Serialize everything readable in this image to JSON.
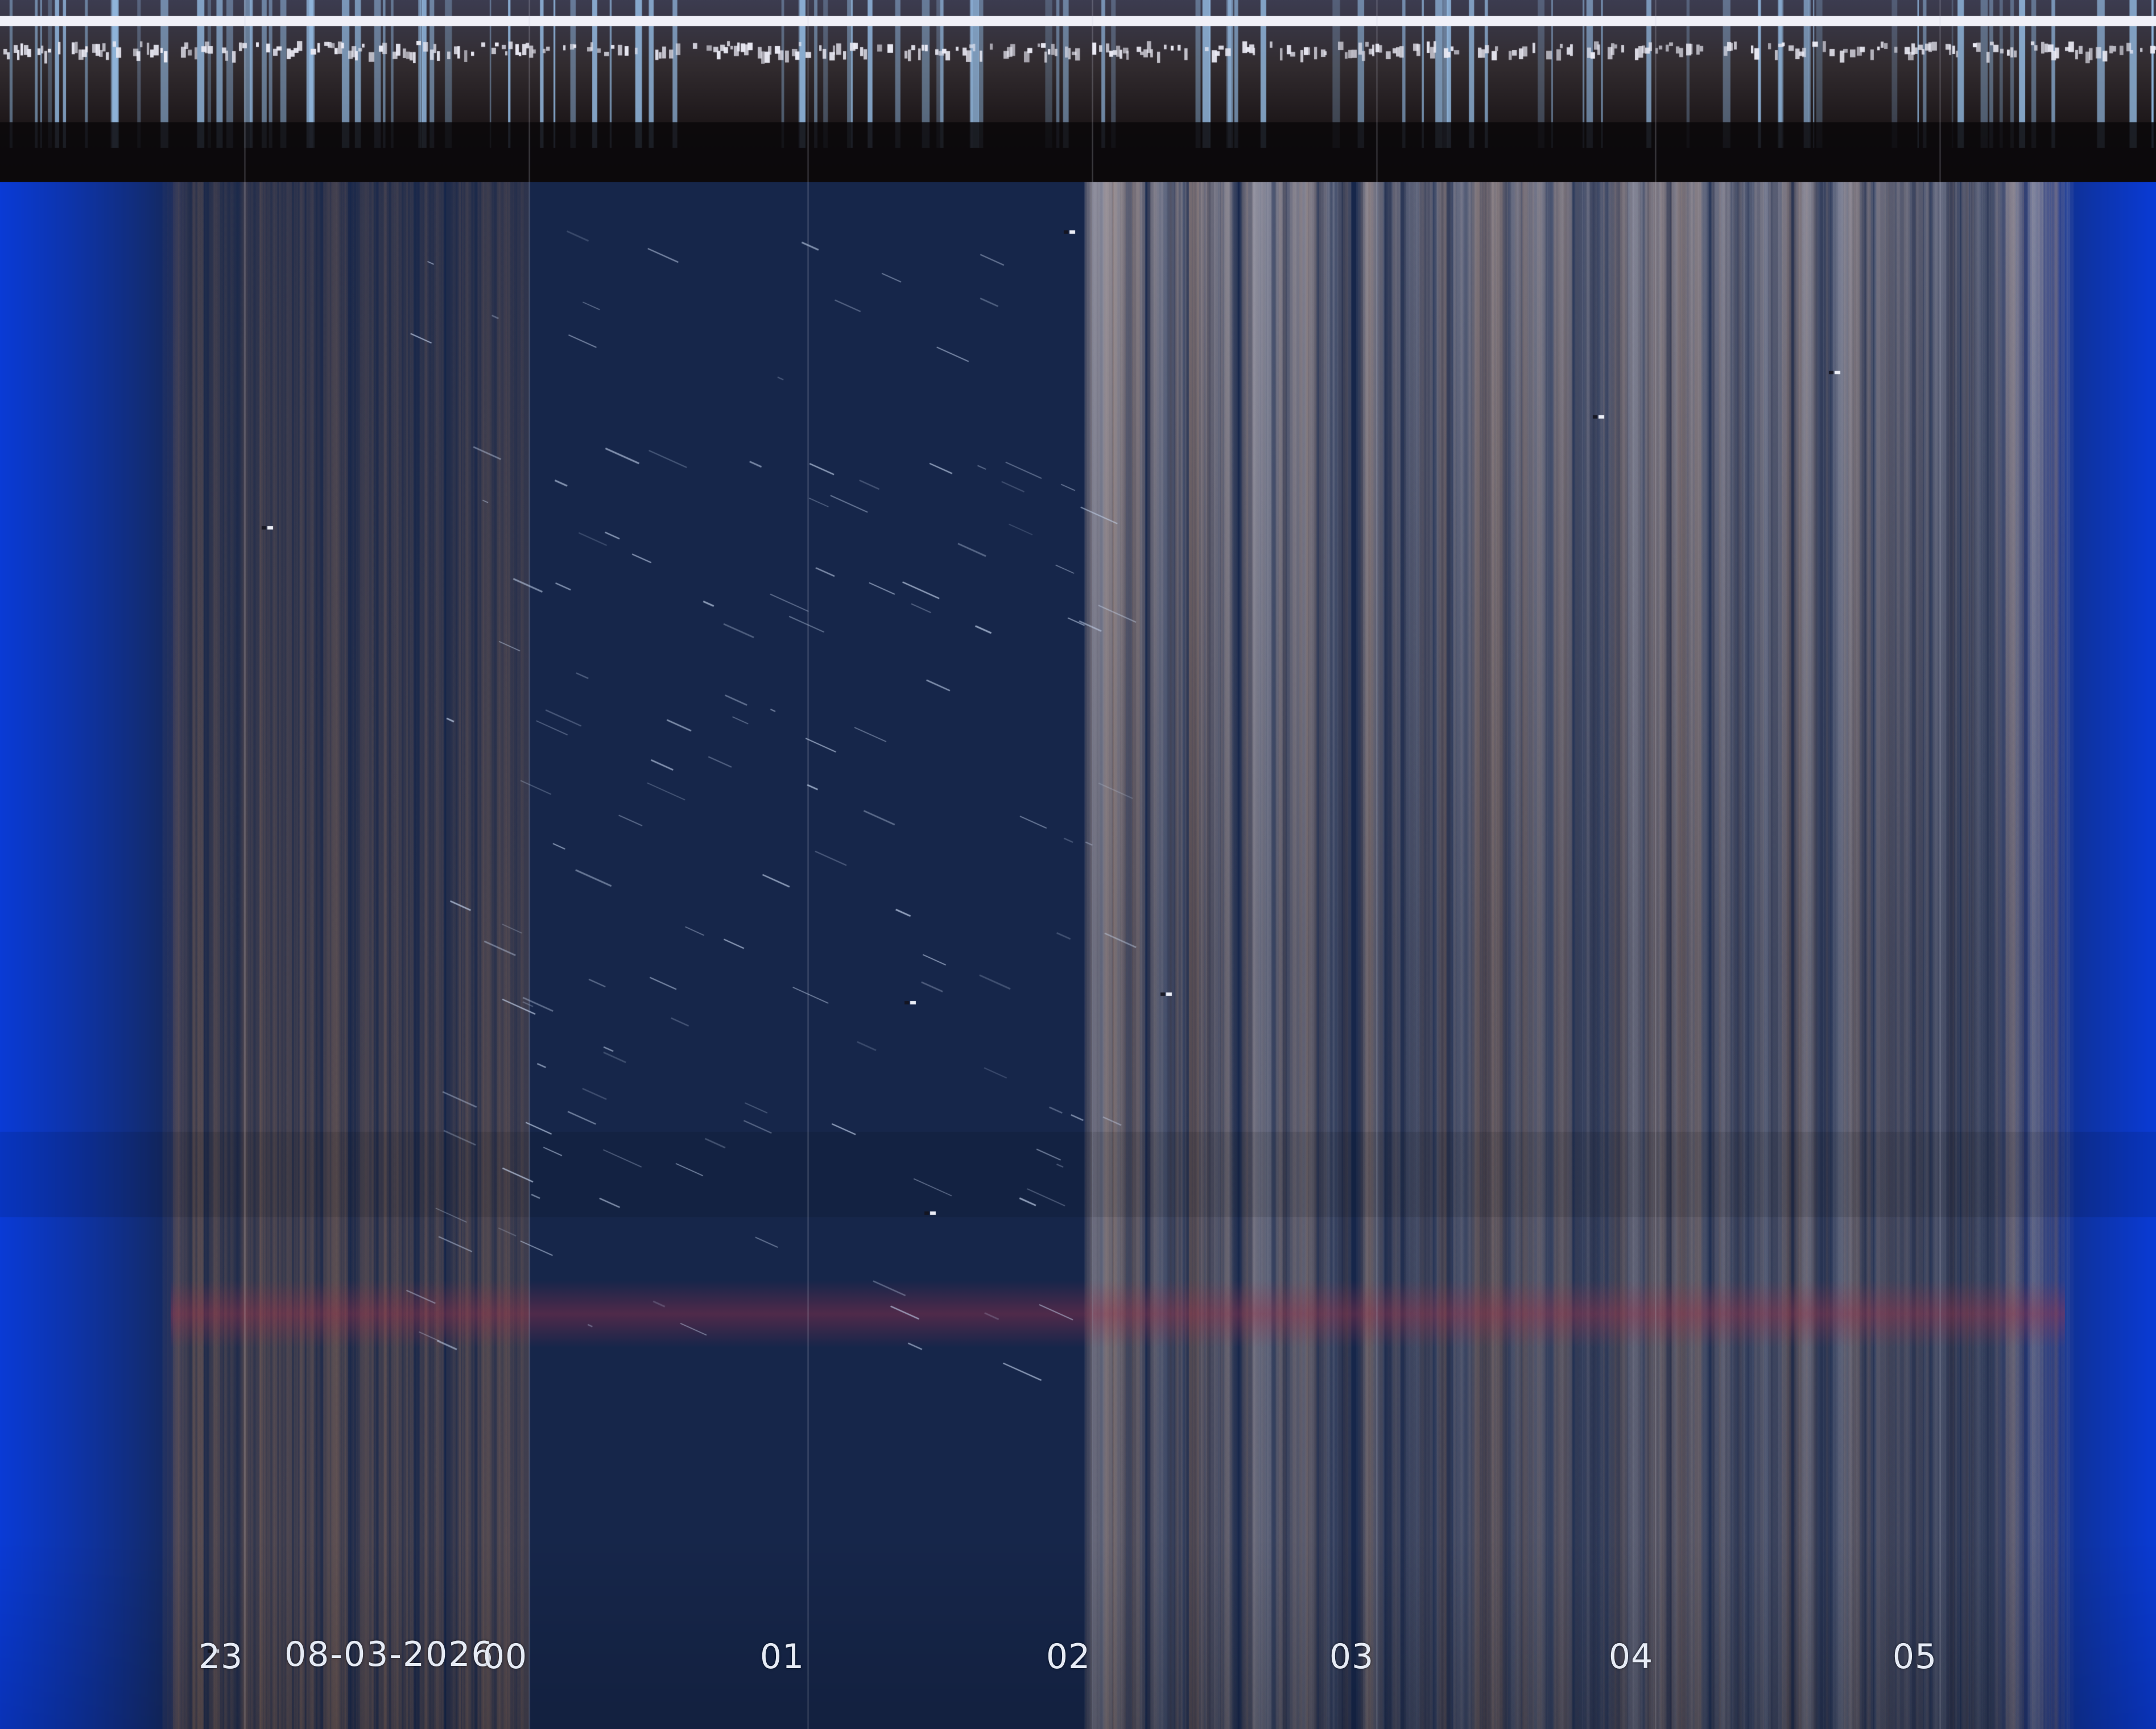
{
  "image": {
    "kind": "all-sky keogram",
    "date_label": "08-03-2026",
    "hour_labels": [
      "23",
      "00",
      "01",
      "02",
      "03",
      "04",
      "05"
    ]
  },
  "colors": {
    "twilight_blue": "#0a3bd6",
    "night_sky": "#16264a",
    "cloud_gray": "#8c8c9a",
    "cloud_warm": "#8a6a58",
    "red_band": "#a0304a",
    "header_dark": "#2a2024",
    "tick_white": "#e6ebf5"
  }
}
